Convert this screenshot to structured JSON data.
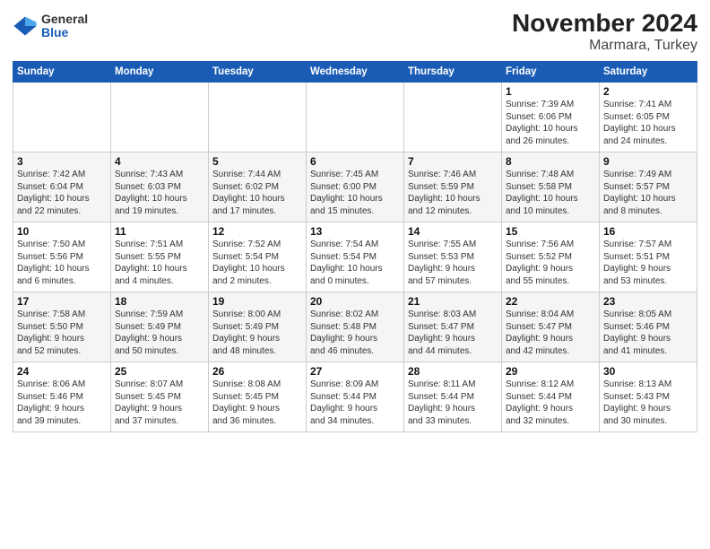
{
  "header": {
    "logo_general": "General",
    "logo_blue": "Blue",
    "title": "November 2024",
    "subtitle": "Marmara, Turkey"
  },
  "weekdays": [
    "Sunday",
    "Monday",
    "Tuesday",
    "Wednesday",
    "Thursday",
    "Friday",
    "Saturday"
  ],
  "weeks": [
    [
      {
        "day": "",
        "info": ""
      },
      {
        "day": "",
        "info": ""
      },
      {
        "day": "",
        "info": ""
      },
      {
        "day": "",
        "info": ""
      },
      {
        "day": "",
        "info": ""
      },
      {
        "day": "1",
        "info": "Sunrise: 7:39 AM\nSunset: 6:06 PM\nDaylight: 10 hours\nand 26 minutes."
      },
      {
        "day": "2",
        "info": "Sunrise: 7:41 AM\nSunset: 6:05 PM\nDaylight: 10 hours\nand 24 minutes."
      }
    ],
    [
      {
        "day": "3",
        "info": "Sunrise: 7:42 AM\nSunset: 6:04 PM\nDaylight: 10 hours\nand 22 minutes."
      },
      {
        "day": "4",
        "info": "Sunrise: 7:43 AM\nSunset: 6:03 PM\nDaylight: 10 hours\nand 19 minutes."
      },
      {
        "day": "5",
        "info": "Sunrise: 7:44 AM\nSunset: 6:02 PM\nDaylight: 10 hours\nand 17 minutes."
      },
      {
        "day": "6",
        "info": "Sunrise: 7:45 AM\nSunset: 6:00 PM\nDaylight: 10 hours\nand 15 minutes."
      },
      {
        "day": "7",
        "info": "Sunrise: 7:46 AM\nSunset: 5:59 PM\nDaylight: 10 hours\nand 12 minutes."
      },
      {
        "day": "8",
        "info": "Sunrise: 7:48 AM\nSunset: 5:58 PM\nDaylight: 10 hours\nand 10 minutes."
      },
      {
        "day": "9",
        "info": "Sunrise: 7:49 AM\nSunset: 5:57 PM\nDaylight: 10 hours\nand 8 minutes."
      }
    ],
    [
      {
        "day": "10",
        "info": "Sunrise: 7:50 AM\nSunset: 5:56 PM\nDaylight: 10 hours\nand 6 minutes."
      },
      {
        "day": "11",
        "info": "Sunrise: 7:51 AM\nSunset: 5:55 PM\nDaylight: 10 hours\nand 4 minutes."
      },
      {
        "day": "12",
        "info": "Sunrise: 7:52 AM\nSunset: 5:54 PM\nDaylight: 10 hours\nand 2 minutes."
      },
      {
        "day": "13",
        "info": "Sunrise: 7:54 AM\nSunset: 5:54 PM\nDaylight: 10 hours\nand 0 minutes."
      },
      {
        "day": "14",
        "info": "Sunrise: 7:55 AM\nSunset: 5:53 PM\nDaylight: 9 hours\nand 57 minutes."
      },
      {
        "day": "15",
        "info": "Sunrise: 7:56 AM\nSunset: 5:52 PM\nDaylight: 9 hours\nand 55 minutes."
      },
      {
        "day": "16",
        "info": "Sunrise: 7:57 AM\nSunset: 5:51 PM\nDaylight: 9 hours\nand 53 minutes."
      }
    ],
    [
      {
        "day": "17",
        "info": "Sunrise: 7:58 AM\nSunset: 5:50 PM\nDaylight: 9 hours\nand 52 minutes."
      },
      {
        "day": "18",
        "info": "Sunrise: 7:59 AM\nSunset: 5:49 PM\nDaylight: 9 hours\nand 50 minutes."
      },
      {
        "day": "19",
        "info": "Sunrise: 8:00 AM\nSunset: 5:49 PM\nDaylight: 9 hours\nand 48 minutes."
      },
      {
        "day": "20",
        "info": "Sunrise: 8:02 AM\nSunset: 5:48 PM\nDaylight: 9 hours\nand 46 minutes."
      },
      {
        "day": "21",
        "info": "Sunrise: 8:03 AM\nSunset: 5:47 PM\nDaylight: 9 hours\nand 44 minutes."
      },
      {
        "day": "22",
        "info": "Sunrise: 8:04 AM\nSunset: 5:47 PM\nDaylight: 9 hours\nand 42 minutes."
      },
      {
        "day": "23",
        "info": "Sunrise: 8:05 AM\nSunset: 5:46 PM\nDaylight: 9 hours\nand 41 minutes."
      }
    ],
    [
      {
        "day": "24",
        "info": "Sunrise: 8:06 AM\nSunset: 5:46 PM\nDaylight: 9 hours\nand 39 minutes."
      },
      {
        "day": "25",
        "info": "Sunrise: 8:07 AM\nSunset: 5:45 PM\nDaylight: 9 hours\nand 37 minutes."
      },
      {
        "day": "26",
        "info": "Sunrise: 8:08 AM\nSunset: 5:45 PM\nDaylight: 9 hours\nand 36 minutes."
      },
      {
        "day": "27",
        "info": "Sunrise: 8:09 AM\nSunset: 5:44 PM\nDaylight: 9 hours\nand 34 minutes."
      },
      {
        "day": "28",
        "info": "Sunrise: 8:11 AM\nSunset: 5:44 PM\nDaylight: 9 hours\nand 33 minutes."
      },
      {
        "day": "29",
        "info": "Sunrise: 8:12 AM\nSunset: 5:44 PM\nDaylight: 9 hours\nand 32 minutes."
      },
      {
        "day": "30",
        "info": "Sunrise: 8:13 AM\nSunset: 5:43 PM\nDaylight: 9 hours\nand 30 minutes."
      }
    ]
  ]
}
